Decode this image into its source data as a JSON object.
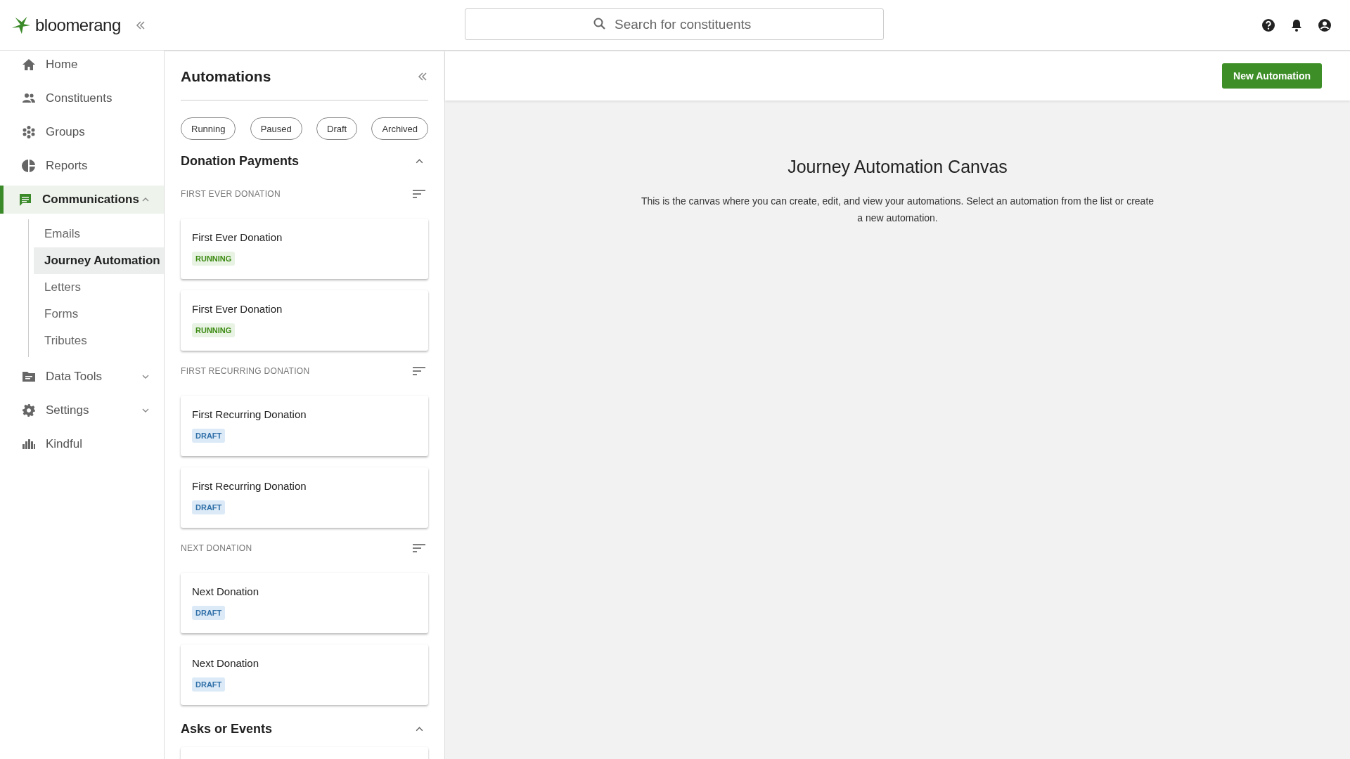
{
  "brand": {
    "name": "bloomerang"
  },
  "search": {
    "placeholder": "Search for constituents"
  },
  "nav": [
    {
      "label": "Home",
      "selected": false
    },
    {
      "label": "Constituents",
      "selected": false
    },
    {
      "label": "Groups",
      "selected": false
    },
    {
      "label": "Reports",
      "selected": false
    },
    {
      "label": "Communications",
      "selected": true,
      "expanded": true,
      "children": [
        {
          "label": "Emails",
          "selected": false
        },
        {
          "label": "Journey Automation",
          "selected": true
        },
        {
          "label": "Letters",
          "selected": false
        },
        {
          "label": "Forms",
          "selected": false
        },
        {
          "label": "Tributes",
          "selected": false
        }
      ]
    },
    {
      "label": "Data Tools",
      "selected": false,
      "expanded": false
    },
    {
      "label": "Settings",
      "selected": false,
      "expanded": false
    },
    {
      "label": "Kindful",
      "selected": false
    }
  ],
  "panel": {
    "title": "Automations",
    "filters": [
      {
        "label": "Running"
      },
      {
        "label": "Paused"
      },
      {
        "label": "Draft"
      },
      {
        "label": "Archived"
      }
    ],
    "sections": [
      {
        "title": "Donation Payments",
        "expanded": true,
        "groups": [
          {
            "label": "FIRST EVER DONATION",
            "items": [
              {
                "name": "First Ever Donation",
                "status": {
                  "label": "RUNNING",
                  "kind": "running"
                }
              },
              {
                "name": "First Ever Donation",
                "status": {
                  "label": "RUNNING",
                  "kind": "running"
                }
              }
            ]
          },
          {
            "label": "FIRST RECURRING DONATION",
            "items": [
              {
                "name": "First Recurring Donation",
                "status": {
                  "label": "DRAFT",
                  "kind": "draft"
                }
              },
              {
                "name": "First Recurring Donation",
                "status": {
                  "label": "DRAFT",
                  "kind": "draft"
                }
              }
            ]
          },
          {
            "label": "NEXT DONATION",
            "items": [
              {
                "name": "Next Donation",
                "status": {
                  "label": "DRAFT",
                  "kind": "draft"
                }
              },
              {
                "name": "Next Donation",
                "status": {
                  "label": "DRAFT",
                  "kind": "draft"
                }
              }
            ]
          }
        ]
      },
      {
        "title": "Asks or Events",
        "expanded": true
      }
    ]
  },
  "toolbar": {
    "button": "New Automation"
  },
  "canvas": {
    "title": "Journey Automation Canvas",
    "description": "This is the canvas where you can create, edit, and view your automations. Select an automation from the list or create a new automation."
  }
}
